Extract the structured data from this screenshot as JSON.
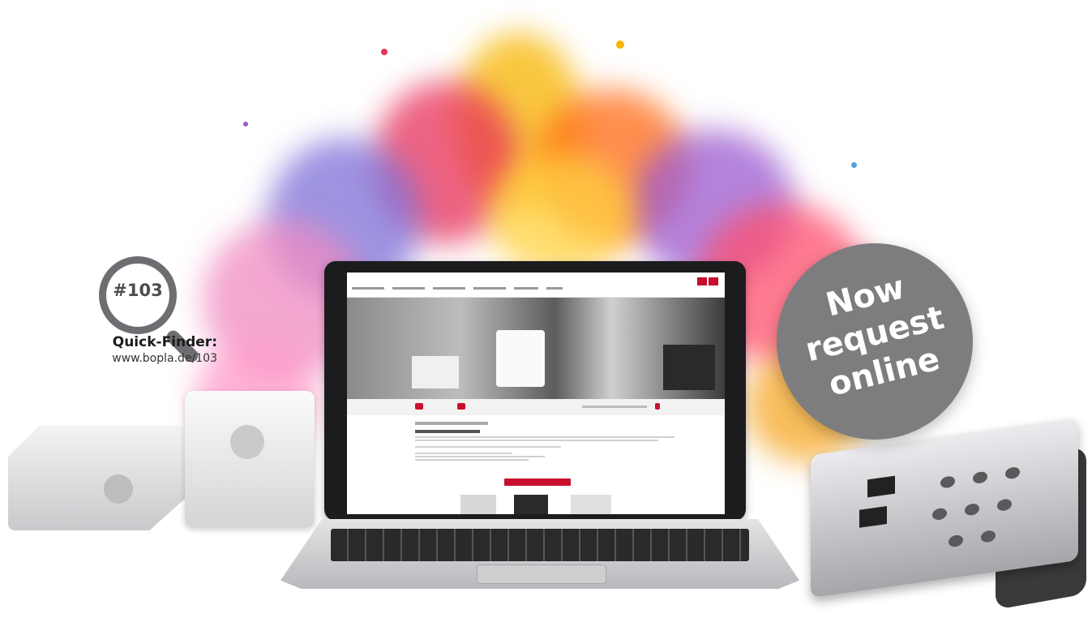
{
  "quick_finder": {
    "number": "#103",
    "label": "Quick-Finder:",
    "url": "www.bopla.de/103"
  },
  "badge": {
    "line1": "Now",
    "line2": "request",
    "line3": "online"
  },
  "colors": {
    "badge_gray": "#7d7d7f",
    "brand_red": "#c8102e",
    "magnifier_gray": "#6d6e71"
  }
}
